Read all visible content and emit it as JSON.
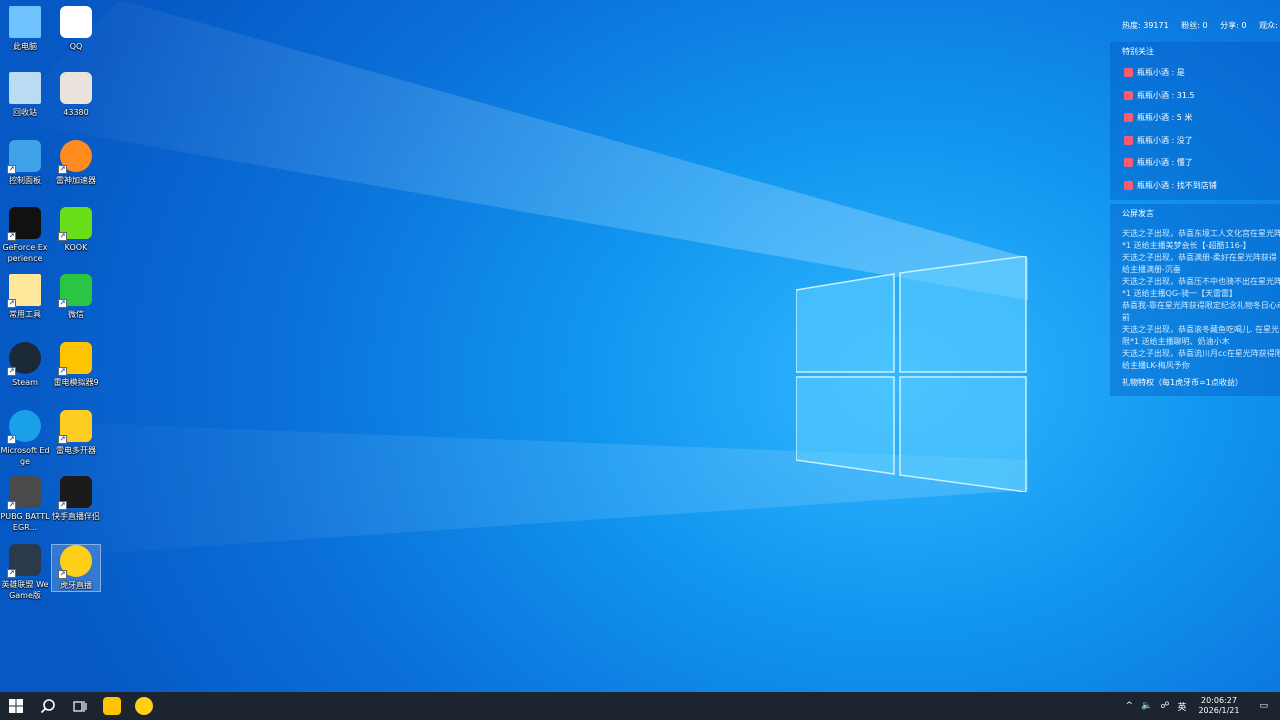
{
  "desktop": {
    "icons": [
      {
        "label": "此电脑",
        "icon": "this-pc-icon"
      },
      {
        "label": "QQ",
        "icon": "qq-icon"
      },
      {
        "label": "回收站",
        "icon": "recycle-bin-icon"
      },
      {
        "label": "43380",
        "icon": "avatar-icon"
      },
      {
        "label": "控制面板",
        "icon": "control-panel-icon"
      },
      {
        "label": "雷神加速器",
        "icon": "accelerator-icon"
      },
      {
        "label": "GeForce Experience",
        "icon": "nvidia-icon"
      },
      {
        "label": "KOOK",
        "icon": "kook-icon"
      },
      {
        "label": "常用工具",
        "icon": "folder-icon"
      },
      {
        "label": "微信",
        "icon": "wechat-icon"
      },
      {
        "label": "Steam",
        "icon": "steam-icon"
      },
      {
        "label": "雷电模拟器9",
        "icon": "ldplayer-icon"
      },
      {
        "label": "Microsoft Edge",
        "icon": "edge-icon"
      },
      {
        "label": "雷电多开器",
        "icon": "multi-instance-icon"
      },
      {
        "label": "PUBG BATTLEGR...",
        "icon": "pubg-icon"
      },
      {
        "label": "快手直播伴侣",
        "icon": "kuaishou-icon"
      },
      {
        "label": "英雄联盟 WeGame版",
        "icon": "lol-icon"
      },
      {
        "label": "虎牙直播",
        "icon": "huya-icon"
      }
    ]
  },
  "overlay": {
    "stats": {
      "heat": "热度: 39171",
      "fans": "粉丝: 0",
      "share": "分享: 0",
      "watch": "观众:"
    },
    "follow_title": "特别关注",
    "follow_items": [
      "瓶瓶小酒 : 是",
      "瓶瓶小酒 : 31.5",
      "瓶瓶小酒 : 5 米",
      "瓶瓶小酒 : 没了",
      "瓶瓶小酒 : 懂了",
      "瓶瓶小酒 : 找不到店铺"
    ],
    "chat_title": "公屏发言",
    "chat_lines": [
      "天选之子出现，恭喜东境工人文化宫在星光阵",
      "*1 送给主播美梦会长【-超酷116-】",
      "天选之子出现，恭喜满册-柔好在星光阵获得",
      "给主播满册-沉垂",
      "天选之子出现，恭喜压不中也骑不出在星光阵",
      "*1 送给主播QG-骑一【天雷雷】",
      "恭喜我-靠在星光阵获得限定纪念礼物冬日心动",
      "前",
      "天选之子出现，恭喜滚冬藏鱼吃喝儿. 在星光",
      "限*1 送给主播聊明、奶油小木",
      "天选之子出现，恭喜流川月cc在星光阵获得限",
      "给主播LK-梅风予你"
    ],
    "gift_title": "礼物特权（每1虎牙币=1点收益）"
  },
  "taskbar": {
    "tray_ime": "英",
    "time": "20:06:27",
    "date": "2026/1/21"
  }
}
